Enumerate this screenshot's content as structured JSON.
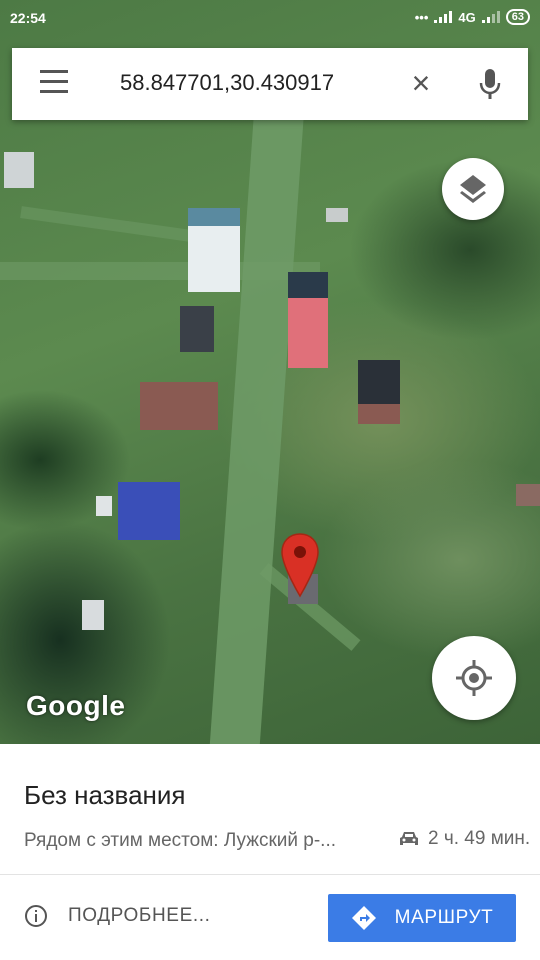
{
  "status_bar": {
    "time": "22:54",
    "network": "4G",
    "battery": "63"
  },
  "search": {
    "query": "58.847701,30.430917"
  },
  "map": {
    "logo": "Google",
    "pin_color": "#d93025"
  },
  "sheet": {
    "title": "Без названия",
    "nearby": "Рядом с этим местом: Лужский р-...",
    "drive_time": "2 ч. 49 мин.",
    "more_label": "ПОДРОБНЕЕ...",
    "route_label": "МАРШРУТ"
  },
  "colors": {
    "accent": "#3b7ce6"
  }
}
